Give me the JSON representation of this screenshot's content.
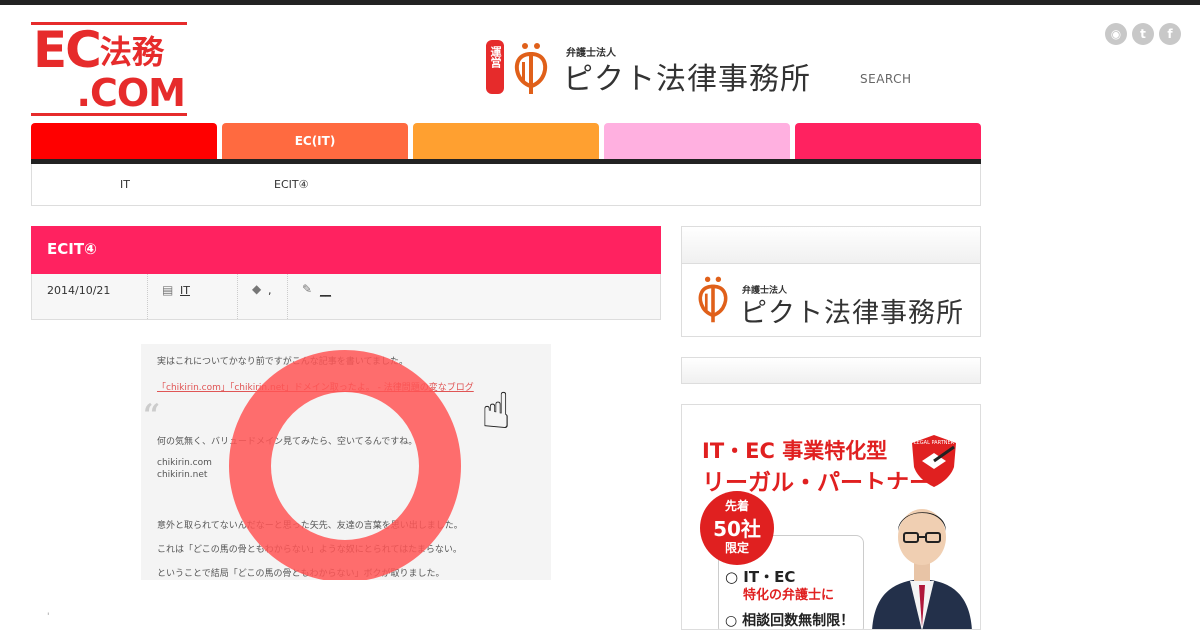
{
  "logo": {
    "top": "EC",
    "jp": "法務",
    "bottom": ".COM"
  },
  "operator": {
    "badge": "運営",
    "sub": "弁護士法人",
    "name": "ピクト法律事務所"
  },
  "search": {
    "label": "SEARCH"
  },
  "social": [
    {
      "name": "rss-icon",
      "glyph": "◉"
    },
    {
      "name": "twitter-icon",
      "glyph": "t"
    },
    {
      "name": "facebook-icon",
      "glyph": "f"
    }
  ],
  "nav": {
    "tabs": [
      {
        "label": "",
        "color": "#ff0000"
      },
      {
        "label": "EC(IT)",
        "color": "#ff6a40"
      },
      {
        "label": "",
        "color": "#ffa030"
      },
      {
        "label": "",
        "color": "#ffb0e0"
      },
      {
        "label": "",
        "color": "#ff2260"
      }
    ]
  },
  "breadcrumb": {
    "items": [
      "IT",
      "ECIT④"
    ]
  },
  "post": {
    "title": "ECIT④",
    "date": "2014/10/21",
    "category": "IT",
    "tags": ",",
    "author": "__"
  },
  "post_image": {
    "lines": [
      "実はこれについてかなり前ですがこんな記事を書いてました。",
      "「chikirin.com」「chikirin.net」ドメイン取ったよ。 - 法律問題の変なブログ",
      "何の気無く、バリュードメイン見てみたら、空いてるんですね。",
      "chikirin.com",
      "chikirin.net",
      "意外と取られてないんだなーと思った矢先、友達の言葉を思い出しました。",
      "これは「どこの馬の骨ともわからない」ような奴にとられてはたまらない。",
      "ということで結局「どこの馬の骨ともわからない」ボクが取りました。"
    ]
  },
  "sidebar": {
    "firm_sub": "弁護士法人",
    "firm_name": "ピクト法律事務所"
  },
  "ad": {
    "headline1": "IT・EC 事業特化型",
    "headline2": "リーガル・パートナー",
    "badge_top": "先着",
    "badge_mid": "50社",
    "badge_bottom": "限定",
    "point1": "○ IT・EC",
    "point1_sub": "特化の弁護士に",
    "point2": "○ 相談回数無制限！",
    "shield_text": "LEGAL PARTNER"
  }
}
